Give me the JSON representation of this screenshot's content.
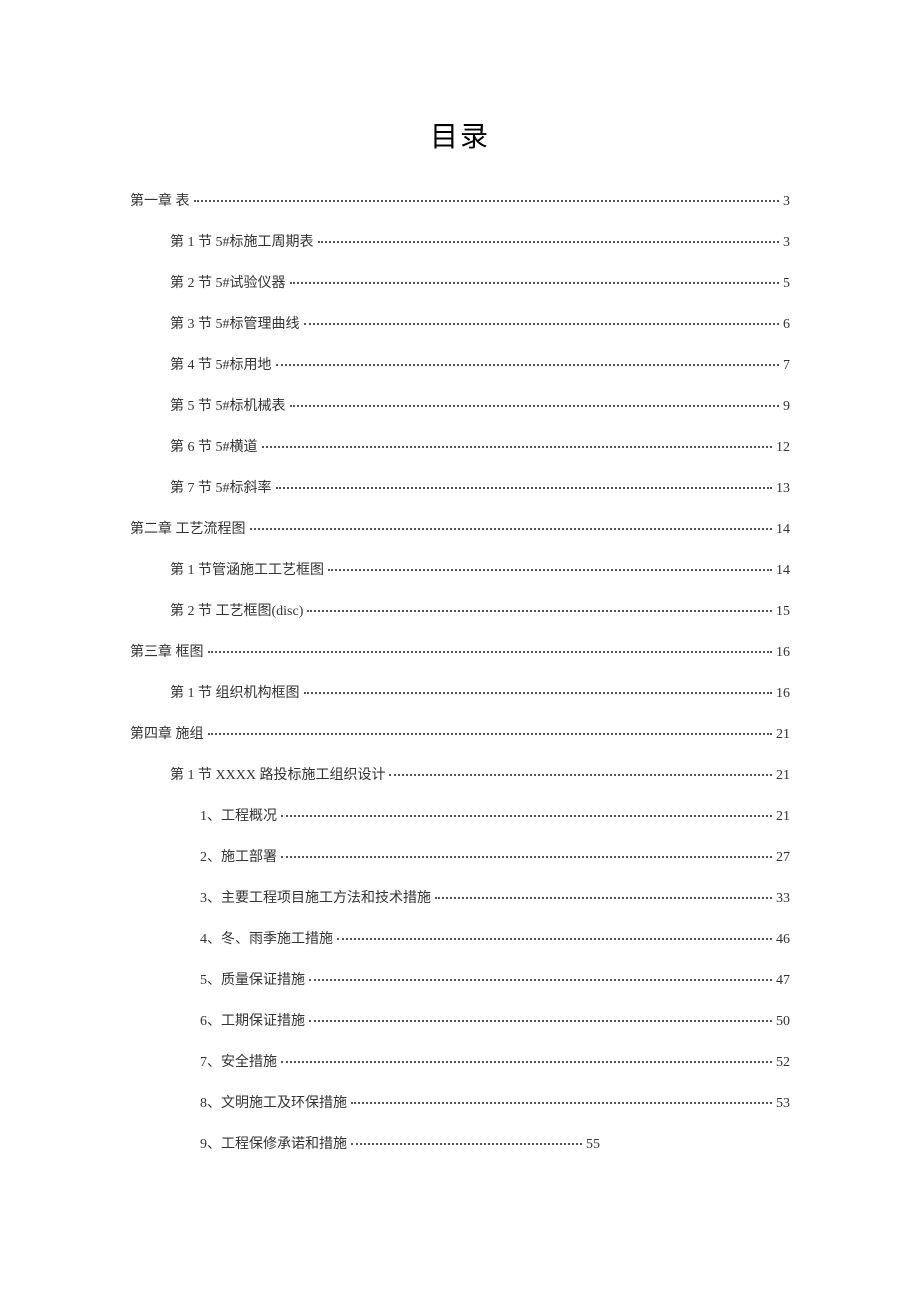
{
  "title": "目录",
  "entries": [
    {
      "label": "第一章 表",
      "page": "3",
      "level": 0
    },
    {
      "label": "第 1 节 5#标施工周期表",
      "page": "3",
      "level": 1
    },
    {
      "label": "第 2 节 5#试验仪器",
      "page": "5",
      "level": 1
    },
    {
      "label": "第 3 节 5#标管理曲线",
      "page": "6",
      "level": 1
    },
    {
      "label": "第 4 节 5#标用地",
      "page": "7",
      "level": 1
    },
    {
      "label": "第 5 节 5#标机械表",
      "page": "9",
      "level": 1
    },
    {
      "label": "第 6 节 5#横道",
      "page": "12",
      "level": 1
    },
    {
      "label": "第 7 节 5#标斜率",
      "page": "13",
      "level": 1
    },
    {
      "label": "第二章 工艺流程图",
      "page": "14",
      "level": 0
    },
    {
      "label": "第 1 节管涵施工工艺框图",
      "page": "14",
      "level": 1
    },
    {
      "label": "第 2 节 工艺框图(disc)",
      "page": "15",
      "level": 1
    },
    {
      "label": "第三章 框图",
      "page": "16",
      "level": 0
    },
    {
      "label": "第 1 节   组织机构框图",
      "page": "16",
      "level": 1
    },
    {
      "label": "第四章 施组",
      "page": "21",
      "level": 0
    },
    {
      "label": "第 1 节 XXXX 路投标施工组织设计",
      "page": "21",
      "level": 1
    },
    {
      "label": "1、工程概况",
      "page": "21",
      "level": 2
    },
    {
      "label": "2、施工部署",
      "page": "27",
      "level": 2
    },
    {
      "label": "3、主要工程项目施工方法和技术措施",
      "page": "33",
      "level": 2
    },
    {
      "label": "4、冬、雨季施工措施",
      "page": "46",
      "level": 2
    },
    {
      "label": "5、质量保证措施",
      "page": "47",
      "level": 2
    },
    {
      "label": "6、工期保证措施",
      "page": "50",
      "level": 2
    },
    {
      "label": "7、安全措施",
      "page": "52",
      "level": 2
    },
    {
      "label": "8、文明施工及环保措施",
      "page": "53",
      "level": 2
    },
    {
      "label": "9、工程保修承诺和措施",
      "page": "55",
      "level": 2,
      "short": true
    }
  ]
}
